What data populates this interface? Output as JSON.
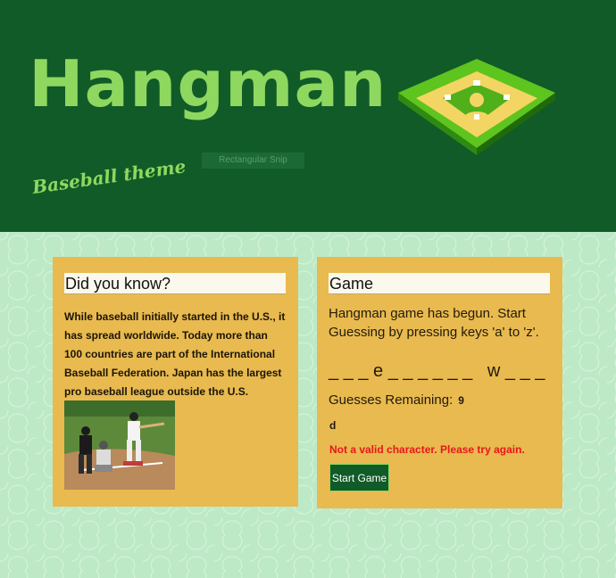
{
  "header": {
    "title": "Hangman",
    "subtitle": "Baseball theme",
    "snip_label": "Rectangular Snip",
    "logo_icon": "baseball-diamond-icon"
  },
  "colors": {
    "header_bg": "#115b28",
    "title_green": "#8ed860",
    "page_bg": "#bde9c7",
    "card_bg": "#e8ba4f",
    "error_red": "#e8171b"
  },
  "did_you_know": {
    "heading": "Did you know?",
    "fact": "While baseball initially started in the U.S., it has spread worldwide. Today more than 100 countries are part of the International Baseball Federation. Japan has the largest pro baseball league outside the U.S.",
    "photo": "baseball-batter-photo"
  },
  "game": {
    "heading": "Game",
    "intro": "Hangman game has begun. Start Guessing by pressing keys 'a' to 'z'.",
    "word_display": "_ _ _ e _ _ _ _ _ _   w _ _ _",
    "guesses_label": "Guesses Remaining:",
    "guesses_remaining": "9",
    "guessed_letters": "d",
    "error": "Not a valid character. Please try again.",
    "start_button": "Start Game"
  }
}
